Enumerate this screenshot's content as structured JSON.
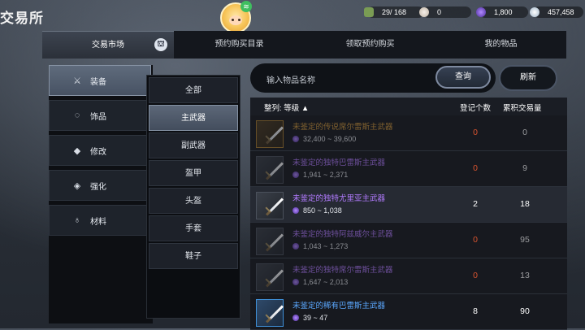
{
  "window": {
    "title": "交易所"
  },
  "currencies": [
    {
      "icon": "contribution-icon",
      "value": "29/ 168"
    },
    {
      "icon": "silver-pearl-icon",
      "value": "0"
    },
    {
      "icon": "purple-gem-icon",
      "value": "1,800"
    },
    {
      "icon": "silver-coin-icon",
      "value": "457,458"
    }
  ],
  "tabs": [
    {
      "label": "交易市场",
      "active": true
    },
    {
      "label": "预约购买目录"
    },
    {
      "label": "领取预约购买"
    },
    {
      "label": "我的物品"
    }
  ],
  "categories": [
    {
      "icon": "crossed-swords-icon",
      "label": "装备",
      "active": true
    },
    {
      "icon": "ring-icon",
      "label": "饰品"
    },
    {
      "icon": "gem-icon",
      "label": "修改"
    },
    {
      "icon": "enhance-icon",
      "label": "强化"
    },
    {
      "icon": "potion-icon",
      "label": "材料"
    }
  ],
  "subcategories": [
    {
      "label": "全部"
    },
    {
      "label": "主武器",
      "active": true
    },
    {
      "label": "副武器"
    },
    {
      "label": "盔甲"
    },
    {
      "label": "头盔"
    },
    {
      "label": "手套"
    },
    {
      "label": "鞋子"
    }
  ],
  "search": {
    "placeholder": "输入物品名称",
    "query_label": "查询",
    "refresh_label": "刷新"
  },
  "table": {
    "sort_label": "整列: 等级 ▲",
    "col_count": "登记个数",
    "col_total": "累积交易量",
    "rows": [
      {
        "name": "未鉴定的传说席尔雷斯主武器",
        "price": "32,400 ~ 39,600",
        "count": "0",
        "total": "0",
        "color": "#d59a3c",
        "frame": "gold",
        "dim": true
      },
      {
        "name": "未鉴定的独特巴雷斯主武器",
        "price": "1,941 ~ 2,371",
        "count": "0",
        "total": "9",
        "color": "#b27bff",
        "frame": "grey",
        "dim": true
      },
      {
        "name": "未鉴定的独特尤里亚主武器",
        "price": "850 ~ 1,038",
        "count": "2",
        "total": "18",
        "color": "#b27bff",
        "frame": "grey",
        "dim": false
      },
      {
        "name": "未鉴定的独特阿兹威尔主武器",
        "price": "1,043 ~ 1,273",
        "count": "0",
        "total": "95",
        "color": "#b27bff",
        "frame": "grey",
        "dim": true
      },
      {
        "name": "未鉴定的独特席尔雷斯主武器",
        "price": "1,647 ~ 2,013",
        "count": "0",
        "total": "13",
        "color": "#b27bff",
        "frame": "grey",
        "dim": true
      },
      {
        "name": "未鉴定的稀有巴雷斯主武器",
        "price": "39 ~ 47",
        "count": "8",
        "total": "90",
        "color": "#5ba8ff",
        "frame": "blue",
        "dim": false
      }
    ]
  },
  "colors": {
    "count_zero": "#d9542f",
    "count_nonzero": "#ffffff"
  }
}
